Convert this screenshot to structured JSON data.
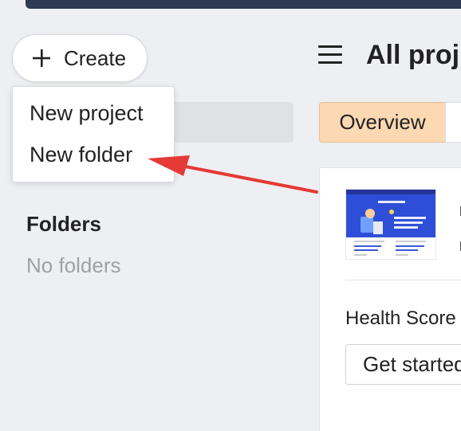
{
  "sidebar": {
    "create_button": {
      "label": "Create",
      "icon": "plus-icon"
    },
    "create_menu": {
      "items": [
        {
          "label": "New project"
        },
        {
          "label": "New folder"
        }
      ]
    },
    "folders": {
      "heading": "Folders",
      "empty_text": "No folders"
    }
  },
  "header": {
    "menu_icon": "hamburger-menu-icon",
    "title": "All proj"
  },
  "tabs": [
    {
      "label": "Overview",
      "active": true,
      "color": "#fcd9b3"
    }
  ],
  "project_card": {
    "health_label": "Health Score",
    "get_started_label": "Get started"
  },
  "annotation": {
    "type": "arrow",
    "color": "#e53935",
    "points_to": "New folder"
  },
  "colors": {
    "topbar": "#2d3a52",
    "background": "#eeeff2",
    "accent_tab": "#fcd9b3",
    "thumbnail_hero": "#2f4ed8"
  }
}
